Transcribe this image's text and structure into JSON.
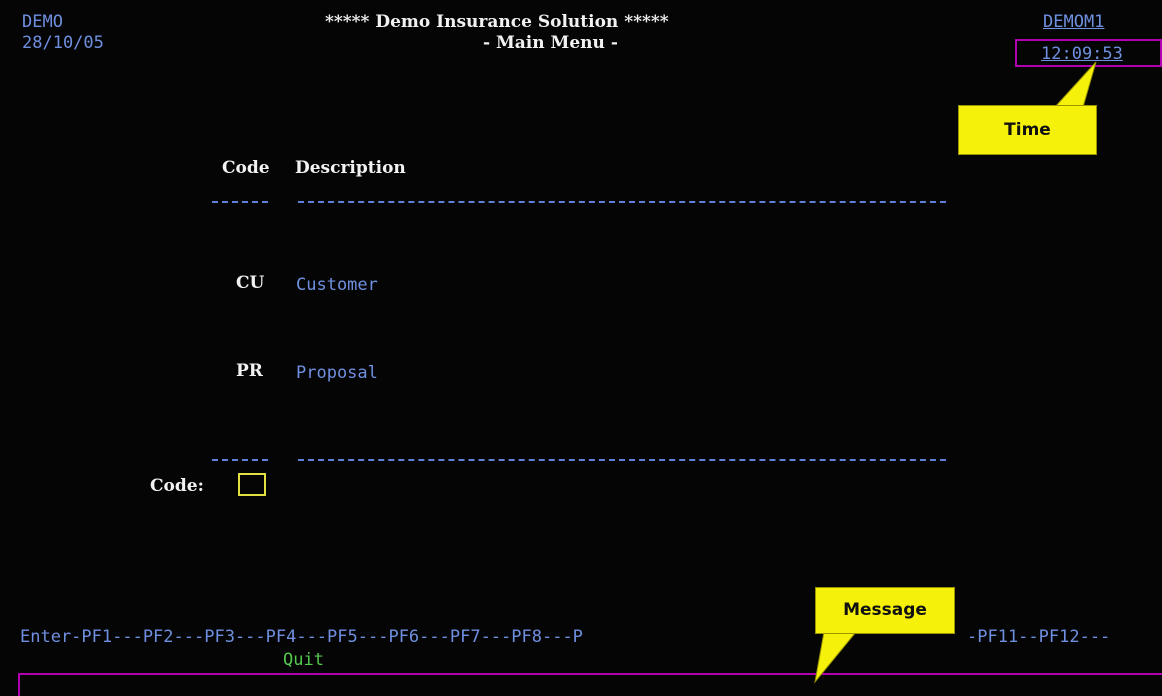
{
  "header": {
    "system_id": "DEMO",
    "date": "28/10/05",
    "title": "***** Demo Insurance Solution *****",
    "subtitle": "- Main Menu -",
    "screen_id": "DEMOM1",
    "time": "12:09:53"
  },
  "menu": {
    "code_header": "Code",
    "description_header": "Description",
    "items": [
      {
        "code": "CU",
        "description": "Customer"
      },
      {
        "code": "PR",
        "description": "Proposal"
      }
    ]
  },
  "code_field": {
    "label": "Code:",
    "value": ""
  },
  "function_keys": {
    "line_left": "Enter-PF1---PF2---PF3---PF4---PF5---PF6---PF7---PF8---P",
    "line_right": "-PF11--PF12---",
    "pf3_action": "Quit"
  },
  "message_line": {
    "text": ""
  },
  "annotations": {
    "time_callout": "Time",
    "message_callout": "Message"
  },
  "colors": {
    "background": "#050505",
    "protected_text": "#6f8fe0",
    "highlight_text": "#f2f2f2",
    "action_text": "#55c84e",
    "input_border": "#e4df43",
    "outline": "#b000b0",
    "callout_fill": "#f6f10a"
  }
}
